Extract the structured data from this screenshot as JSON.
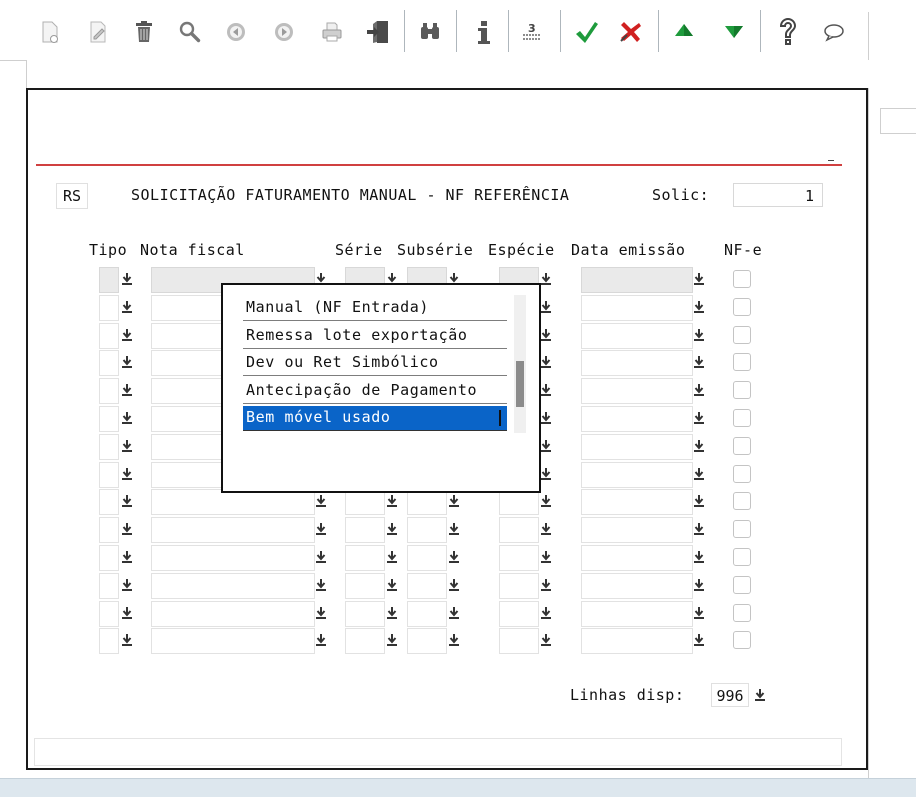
{
  "toolbar": {
    "buttons": [
      "new-icon",
      "edit-icon",
      "delete-icon",
      "search-icon",
      "previous-icon",
      "next-icon",
      "print-icon",
      "exit-icon",
      "binoculars-icon",
      "info-icon",
      "numbered-list-icon",
      "confirm-icon",
      "cancel-icon",
      "up-arrow-icon",
      "down-arrow-icon",
      "help-icon",
      "chat-icon"
    ]
  },
  "form": {
    "state_code": "RS",
    "title": "SOLICITAÇÃO FATURAMENTO MANUAL - NF REFERÊNCIA",
    "solic_label": "Solic:",
    "solic_value": "1",
    "columns": [
      "Tipo",
      "Nota fiscal",
      "Série",
      "Subsérie",
      "Espécie",
      "Data emissão",
      "NF-e"
    ],
    "row_count": 14,
    "linhas_label": "Linhas disp:",
    "linhas_value": "996"
  },
  "popup": {
    "options": [
      "Manual (NF Entrada)",
      "Remessa lote exportação",
      "Dev ou Ret Simbólico",
      "Antecipação de Pagamento",
      "Bem móvel usado"
    ],
    "selected_index": 4
  },
  "colors": {
    "accent_red": "#d04040",
    "selection_blue": "#0a64c8",
    "confirm_green": "#1e9b3c",
    "cancel_red": "#d02020"
  }
}
